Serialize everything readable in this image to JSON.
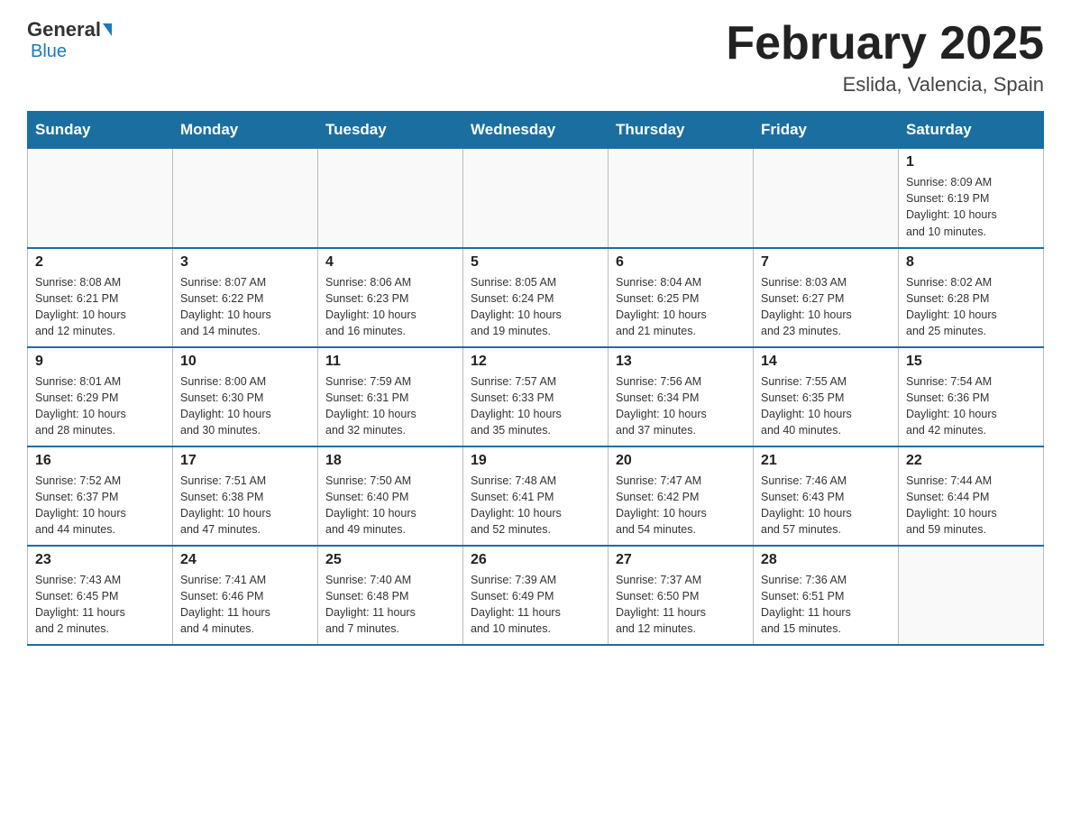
{
  "header": {
    "logo_general": "General",
    "logo_blue": "Blue",
    "title": "February 2025",
    "subtitle": "Eslida, Valencia, Spain"
  },
  "days_of_week": [
    "Sunday",
    "Monday",
    "Tuesday",
    "Wednesday",
    "Thursday",
    "Friday",
    "Saturday"
  ],
  "weeks": [
    [
      {
        "day": "",
        "info": ""
      },
      {
        "day": "",
        "info": ""
      },
      {
        "day": "",
        "info": ""
      },
      {
        "day": "",
        "info": ""
      },
      {
        "day": "",
        "info": ""
      },
      {
        "day": "",
        "info": ""
      },
      {
        "day": "1",
        "info": "Sunrise: 8:09 AM\nSunset: 6:19 PM\nDaylight: 10 hours\nand 10 minutes."
      }
    ],
    [
      {
        "day": "2",
        "info": "Sunrise: 8:08 AM\nSunset: 6:21 PM\nDaylight: 10 hours\nand 12 minutes."
      },
      {
        "day": "3",
        "info": "Sunrise: 8:07 AM\nSunset: 6:22 PM\nDaylight: 10 hours\nand 14 minutes."
      },
      {
        "day": "4",
        "info": "Sunrise: 8:06 AM\nSunset: 6:23 PM\nDaylight: 10 hours\nand 16 minutes."
      },
      {
        "day": "5",
        "info": "Sunrise: 8:05 AM\nSunset: 6:24 PM\nDaylight: 10 hours\nand 19 minutes."
      },
      {
        "day": "6",
        "info": "Sunrise: 8:04 AM\nSunset: 6:25 PM\nDaylight: 10 hours\nand 21 minutes."
      },
      {
        "day": "7",
        "info": "Sunrise: 8:03 AM\nSunset: 6:27 PM\nDaylight: 10 hours\nand 23 minutes."
      },
      {
        "day": "8",
        "info": "Sunrise: 8:02 AM\nSunset: 6:28 PM\nDaylight: 10 hours\nand 25 minutes."
      }
    ],
    [
      {
        "day": "9",
        "info": "Sunrise: 8:01 AM\nSunset: 6:29 PM\nDaylight: 10 hours\nand 28 minutes."
      },
      {
        "day": "10",
        "info": "Sunrise: 8:00 AM\nSunset: 6:30 PM\nDaylight: 10 hours\nand 30 minutes."
      },
      {
        "day": "11",
        "info": "Sunrise: 7:59 AM\nSunset: 6:31 PM\nDaylight: 10 hours\nand 32 minutes."
      },
      {
        "day": "12",
        "info": "Sunrise: 7:57 AM\nSunset: 6:33 PM\nDaylight: 10 hours\nand 35 minutes."
      },
      {
        "day": "13",
        "info": "Sunrise: 7:56 AM\nSunset: 6:34 PM\nDaylight: 10 hours\nand 37 minutes."
      },
      {
        "day": "14",
        "info": "Sunrise: 7:55 AM\nSunset: 6:35 PM\nDaylight: 10 hours\nand 40 minutes."
      },
      {
        "day": "15",
        "info": "Sunrise: 7:54 AM\nSunset: 6:36 PM\nDaylight: 10 hours\nand 42 minutes."
      }
    ],
    [
      {
        "day": "16",
        "info": "Sunrise: 7:52 AM\nSunset: 6:37 PM\nDaylight: 10 hours\nand 44 minutes."
      },
      {
        "day": "17",
        "info": "Sunrise: 7:51 AM\nSunset: 6:38 PM\nDaylight: 10 hours\nand 47 minutes."
      },
      {
        "day": "18",
        "info": "Sunrise: 7:50 AM\nSunset: 6:40 PM\nDaylight: 10 hours\nand 49 minutes."
      },
      {
        "day": "19",
        "info": "Sunrise: 7:48 AM\nSunset: 6:41 PM\nDaylight: 10 hours\nand 52 minutes."
      },
      {
        "day": "20",
        "info": "Sunrise: 7:47 AM\nSunset: 6:42 PM\nDaylight: 10 hours\nand 54 minutes."
      },
      {
        "day": "21",
        "info": "Sunrise: 7:46 AM\nSunset: 6:43 PM\nDaylight: 10 hours\nand 57 minutes."
      },
      {
        "day": "22",
        "info": "Sunrise: 7:44 AM\nSunset: 6:44 PM\nDaylight: 10 hours\nand 59 minutes."
      }
    ],
    [
      {
        "day": "23",
        "info": "Sunrise: 7:43 AM\nSunset: 6:45 PM\nDaylight: 11 hours\nand 2 minutes."
      },
      {
        "day": "24",
        "info": "Sunrise: 7:41 AM\nSunset: 6:46 PM\nDaylight: 11 hours\nand 4 minutes."
      },
      {
        "day": "25",
        "info": "Sunrise: 7:40 AM\nSunset: 6:48 PM\nDaylight: 11 hours\nand 7 minutes."
      },
      {
        "day": "26",
        "info": "Sunrise: 7:39 AM\nSunset: 6:49 PM\nDaylight: 11 hours\nand 10 minutes."
      },
      {
        "day": "27",
        "info": "Sunrise: 7:37 AM\nSunset: 6:50 PM\nDaylight: 11 hours\nand 12 minutes."
      },
      {
        "day": "28",
        "info": "Sunrise: 7:36 AM\nSunset: 6:51 PM\nDaylight: 11 hours\nand 15 minutes."
      },
      {
        "day": "",
        "info": ""
      }
    ]
  ]
}
